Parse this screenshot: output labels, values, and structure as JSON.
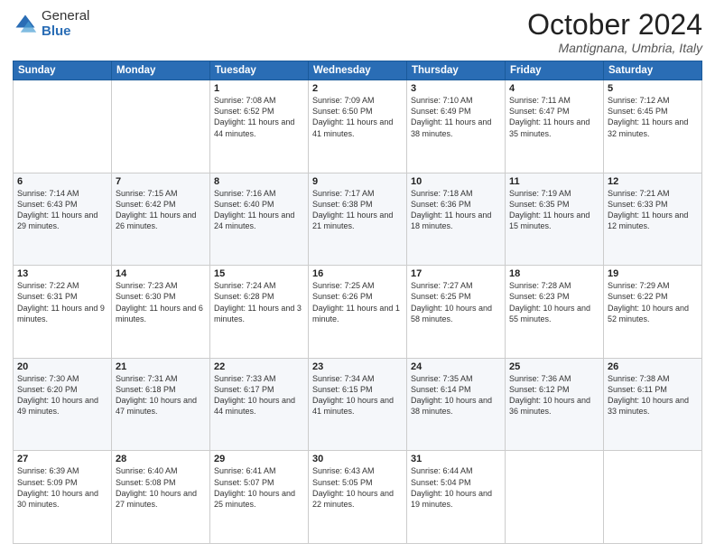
{
  "header": {
    "logo_general": "General",
    "logo_blue": "Blue",
    "month_title": "October 2024",
    "location": "Mantignana, Umbria, Italy"
  },
  "calendar": {
    "days_of_week": [
      "Sunday",
      "Monday",
      "Tuesday",
      "Wednesday",
      "Thursday",
      "Friday",
      "Saturday"
    ],
    "weeks": [
      [
        {
          "day": "",
          "detail": ""
        },
        {
          "day": "",
          "detail": ""
        },
        {
          "day": "1",
          "detail": "Sunrise: 7:08 AM\nSunset: 6:52 PM\nDaylight: 11 hours and 44 minutes."
        },
        {
          "day": "2",
          "detail": "Sunrise: 7:09 AM\nSunset: 6:50 PM\nDaylight: 11 hours and 41 minutes."
        },
        {
          "day": "3",
          "detail": "Sunrise: 7:10 AM\nSunset: 6:49 PM\nDaylight: 11 hours and 38 minutes."
        },
        {
          "day": "4",
          "detail": "Sunrise: 7:11 AM\nSunset: 6:47 PM\nDaylight: 11 hours and 35 minutes."
        },
        {
          "day": "5",
          "detail": "Sunrise: 7:12 AM\nSunset: 6:45 PM\nDaylight: 11 hours and 32 minutes."
        }
      ],
      [
        {
          "day": "6",
          "detail": "Sunrise: 7:14 AM\nSunset: 6:43 PM\nDaylight: 11 hours and 29 minutes."
        },
        {
          "day": "7",
          "detail": "Sunrise: 7:15 AM\nSunset: 6:42 PM\nDaylight: 11 hours and 26 minutes."
        },
        {
          "day": "8",
          "detail": "Sunrise: 7:16 AM\nSunset: 6:40 PM\nDaylight: 11 hours and 24 minutes."
        },
        {
          "day": "9",
          "detail": "Sunrise: 7:17 AM\nSunset: 6:38 PM\nDaylight: 11 hours and 21 minutes."
        },
        {
          "day": "10",
          "detail": "Sunrise: 7:18 AM\nSunset: 6:36 PM\nDaylight: 11 hours and 18 minutes."
        },
        {
          "day": "11",
          "detail": "Sunrise: 7:19 AM\nSunset: 6:35 PM\nDaylight: 11 hours and 15 minutes."
        },
        {
          "day": "12",
          "detail": "Sunrise: 7:21 AM\nSunset: 6:33 PM\nDaylight: 11 hours and 12 minutes."
        }
      ],
      [
        {
          "day": "13",
          "detail": "Sunrise: 7:22 AM\nSunset: 6:31 PM\nDaylight: 11 hours and 9 minutes."
        },
        {
          "day": "14",
          "detail": "Sunrise: 7:23 AM\nSunset: 6:30 PM\nDaylight: 11 hours and 6 minutes."
        },
        {
          "day": "15",
          "detail": "Sunrise: 7:24 AM\nSunset: 6:28 PM\nDaylight: 11 hours and 3 minutes."
        },
        {
          "day": "16",
          "detail": "Sunrise: 7:25 AM\nSunset: 6:26 PM\nDaylight: 11 hours and 1 minute."
        },
        {
          "day": "17",
          "detail": "Sunrise: 7:27 AM\nSunset: 6:25 PM\nDaylight: 10 hours and 58 minutes."
        },
        {
          "day": "18",
          "detail": "Sunrise: 7:28 AM\nSunset: 6:23 PM\nDaylight: 10 hours and 55 minutes."
        },
        {
          "day": "19",
          "detail": "Sunrise: 7:29 AM\nSunset: 6:22 PM\nDaylight: 10 hours and 52 minutes."
        }
      ],
      [
        {
          "day": "20",
          "detail": "Sunrise: 7:30 AM\nSunset: 6:20 PM\nDaylight: 10 hours and 49 minutes."
        },
        {
          "day": "21",
          "detail": "Sunrise: 7:31 AM\nSunset: 6:18 PM\nDaylight: 10 hours and 47 minutes."
        },
        {
          "day": "22",
          "detail": "Sunrise: 7:33 AM\nSunset: 6:17 PM\nDaylight: 10 hours and 44 minutes."
        },
        {
          "day": "23",
          "detail": "Sunrise: 7:34 AM\nSunset: 6:15 PM\nDaylight: 10 hours and 41 minutes."
        },
        {
          "day": "24",
          "detail": "Sunrise: 7:35 AM\nSunset: 6:14 PM\nDaylight: 10 hours and 38 minutes."
        },
        {
          "day": "25",
          "detail": "Sunrise: 7:36 AM\nSunset: 6:12 PM\nDaylight: 10 hours and 36 minutes."
        },
        {
          "day": "26",
          "detail": "Sunrise: 7:38 AM\nSunset: 6:11 PM\nDaylight: 10 hours and 33 minutes."
        }
      ],
      [
        {
          "day": "27",
          "detail": "Sunrise: 6:39 AM\nSunset: 5:09 PM\nDaylight: 10 hours and 30 minutes."
        },
        {
          "day": "28",
          "detail": "Sunrise: 6:40 AM\nSunset: 5:08 PM\nDaylight: 10 hours and 27 minutes."
        },
        {
          "day": "29",
          "detail": "Sunrise: 6:41 AM\nSunset: 5:07 PM\nDaylight: 10 hours and 25 minutes."
        },
        {
          "day": "30",
          "detail": "Sunrise: 6:43 AM\nSunset: 5:05 PM\nDaylight: 10 hours and 22 minutes."
        },
        {
          "day": "31",
          "detail": "Sunrise: 6:44 AM\nSunset: 5:04 PM\nDaylight: 10 hours and 19 minutes."
        },
        {
          "day": "",
          "detail": ""
        },
        {
          "day": "",
          "detail": ""
        }
      ]
    ]
  }
}
